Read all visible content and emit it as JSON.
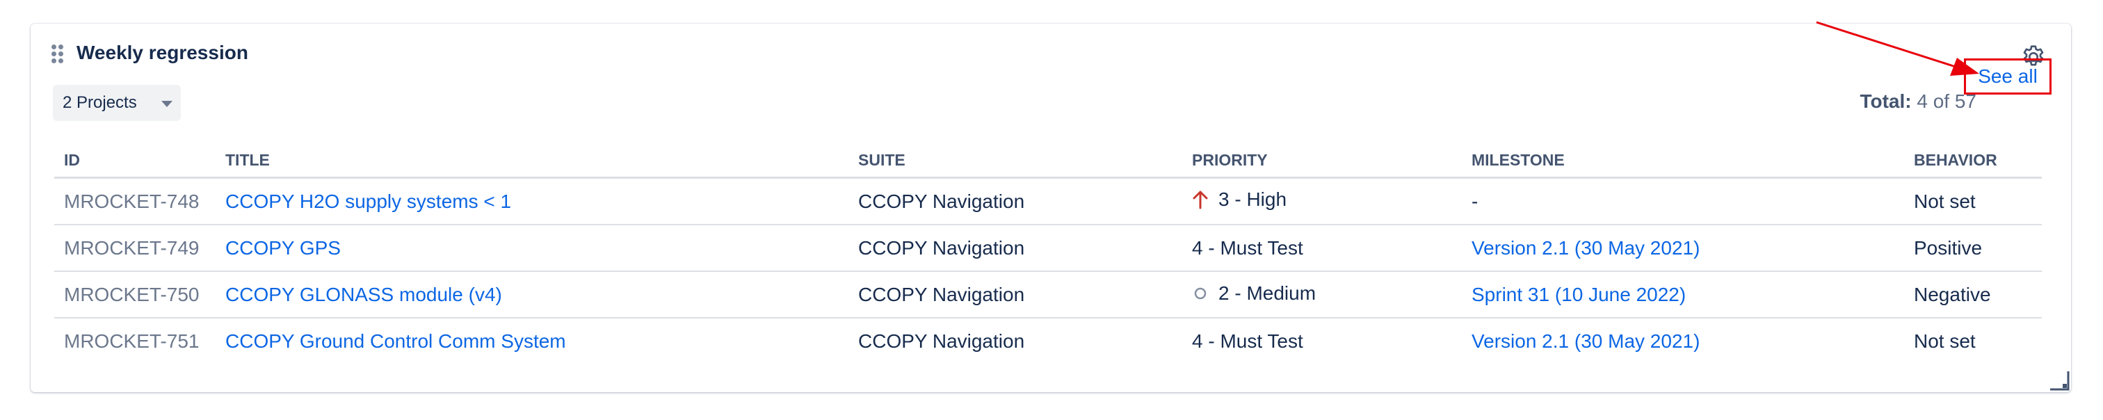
{
  "widget": {
    "title": "Weekly regression",
    "projects_select": "2 Projects",
    "total_label": "Total:",
    "total_value": "4 of 57",
    "see_all": "See all"
  },
  "table": {
    "columns": [
      "ID",
      "TITLE",
      "SUITE",
      "PRIORITY",
      "MILESTONE",
      "BEHAVIOR"
    ],
    "rows": [
      {
        "id": "MROCKET-748",
        "title": "CCOPY H2O supply systems < 1",
        "suite": "CCOPY Navigation",
        "priority": "3 - High",
        "priority_icon": "arrow-up-icon",
        "milestone": "-",
        "milestone_link": false,
        "behavior": "Not set"
      },
      {
        "id": "MROCKET-749",
        "title": "CCOPY GPS",
        "suite": "CCOPY Navigation",
        "priority": "4 - Must Test",
        "priority_icon": "",
        "milestone": "Version 2.1 (30 May 2021)",
        "milestone_link": true,
        "behavior": "Positive"
      },
      {
        "id": "MROCKET-750",
        "title": "CCOPY GLONASS module (v4)",
        "suite": "CCOPY Navigation",
        "priority": "2 - Medium",
        "priority_icon": "circle-icon",
        "milestone": "Sprint 31 (10 June 2022)",
        "milestone_link": true,
        "behavior": "Negative"
      },
      {
        "id": "MROCKET-751",
        "title": "CCOPY Ground Control Comm System",
        "suite": "CCOPY Navigation",
        "priority": "4 - Must Test",
        "priority_icon": "",
        "milestone": "Version 2.1 (30 May 2021)",
        "milestone_link": true,
        "behavior": "Not set"
      }
    ]
  },
  "colors": {
    "link": "#0c66e4",
    "highlight": "#e8000b",
    "priority_high": "#c9372c"
  }
}
